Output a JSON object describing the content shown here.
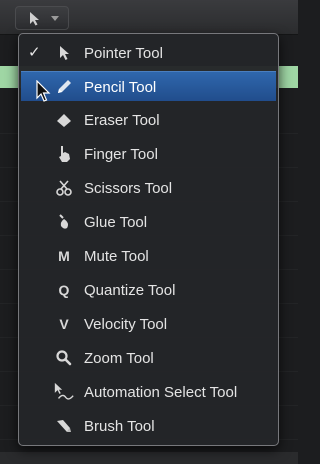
{
  "toolbar": {
    "tool_button_icon": "pointer-icon",
    "tool_button_chevron": "chevron-down-icon"
  },
  "menu": {
    "items": [
      {
        "label": "Pointer Tool",
        "icon": "pointer-icon",
        "checked": true,
        "highlighted": false
      },
      {
        "label": "Pencil Tool",
        "icon": "pencil-icon",
        "checked": false,
        "highlighted": true
      },
      {
        "label": "Eraser Tool",
        "icon": "eraser-icon",
        "checked": false,
        "highlighted": false
      },
      {
        "label": "Finger Tool",
        "icon": "finger-icon",
        "checked": false,
        "highlighted": false
      },
      {
        "label": "Scissors Tool",
        "icon": "scissors-icon",
        "checked": false,
        "highlighted": false
      },
      {
        "label": "Glue Tool",
        "icon": "glue-icon",
        "checked": false,
        "highlighted": false
      },
      {
        "label": "Mute Tool",
        "icon": "mute-icon",
        "glyph": "M",
        "checked": false,
        "highlighted": false
      },
      {
        "label": "Quantize Tool",
        "icon": "quantize-icon",
        "glyph": "Q",
        "checked": false,
        "highlighted": false
      },
      {
        "label": "Velocity Tool",
        "icon": "velocity-icon",
        "glyph": "V",
        "checked": false,
        "highlighted": false
      },
      {
        "label": "Zoom Tool",
        "icon": "magnifier-icon",
        "checked": false,
        "highlighted": false
      },
      {
        "label": "Automation Select Tool",
        "icon": "automation-select-icon",
        "checked": false,
        "highlighted": false
      },
      {
        "label": "Brush Tool",
        "icon": "brush-icon",
        "checked": false,
        "highlighted": false
      }
    ],
    "check_mark": "✓"
  },
  "colors": {
    "highlight": "#2a5ea0",
    "menu_background": "#242528",
    "menu_border": "#77787c",
    "text": "#e4e4e4"
  }
}
